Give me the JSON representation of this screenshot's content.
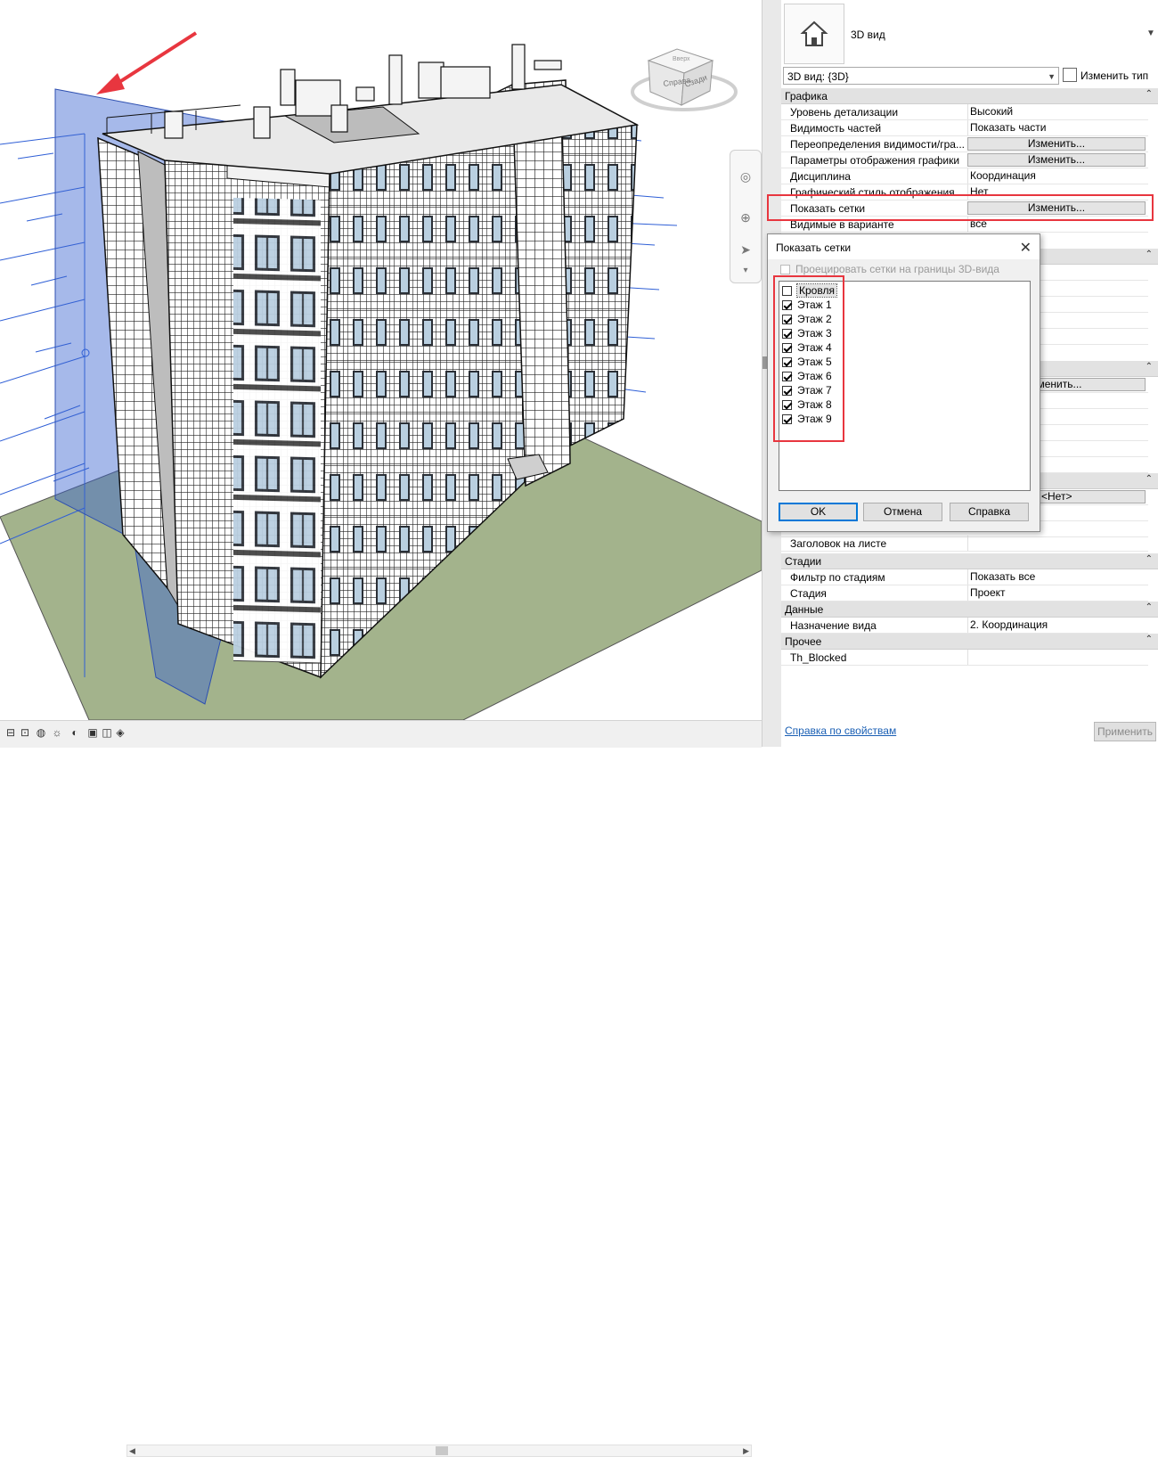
{
  "properties": {
    "type_name": "3D вид",
    "view_instance": "3D вид: {3D}",
    "edit_type_label": "Изменить тип",
    "groups": {
      "graphics": "Графика",
      "stages": "Стадии",
      "data": "Данные",
      "other": "Прочее"
    },
    "rows": {
      "detail_level": {
        "key": "Уровень детализации",
        "value": "Высокий"
      },
      "parts_visibility": {
        "key": "Видимость частей",
        "value": "Показать части"
      },
      "visibility_overrides": {
        "key": "Переопределения видимости/гра...",
        "value": "Изменить..."
      },
      "graphic_display": {
        "key": "Параметры отображения графики",
        "value": "Изменить..."
      },
      "discipline": {
        "key": "Дисциплина",
        "value": "Координация"
      },
      "graphic_style": {
        "key": "Графический стиль отображения",
        "value": "Нет"
      },
      "show_grids": {
        "key": "Показать сетки",
        "value": "Изменить..."
      },
      "visible_in_option": {
        "key": "Видимые в варианте",
        "value": "все"
      },
      "partial_edit": {
        "value": "зменить..."
      },
      "partial_none": {
        "value": "<Нет>"
      },
      "sheet_title": {
        "key": "Заголовок на листе",
        "value": ""
      },
      "phase_filter": {
        "key": "Фильтр по стадиям",
        "value": "Показать все"
      },
      "phase": {
        "key": "Стадия",
        "value": "Проект"
      },
      "view_purpose": {
        "key": "Назначение вида",
        "value": "2. Координация"
      },
      "th_blocked": {
        "key": "Th_Blocked",
        "value": ""
      }
    },
    "help_link": "Справка по свойствам",
    "apply_label": "Применить"
  },
  "dialog": {
    "title": "Показать сетки",
    "project_grids_label": "Проецировать сетки на границы 3D-вида",
    "levels": [
      {
        "name": "Кровля",
        "checked": false
      },
      {
        "name": "Этаж 1",
        "checked": true
      },
      {
        "name": "Этаж 2",
        "checked": true
      },
      {
        "name": "Этаж 3",
        "checked": true
      },
      {
        "name": "Этаж 4",
        "checked": true
      },
      {
        "name": "Этаж 5",
        "checked": true
      },
      {
        "name": "Этаж 6",
        "checked": true
      },
      {
        "name": "Этаж 7",
        "checked": true
      },
      {
        "name": "Этаж 8",
        "checked": true
      },
      {
        "name": "Этаж 9",
        "checked": true
      }
    ],
    "ok_label": "OK",
    "cancel_label": "Отмена",
    "help_label": "Справка"
  },
  "viewcube": {
    "right_face": "Справа",
    "back_face": "Сзади",
    "top_face": "Вверх"
  },
  "colors": {
    "highlight_red": "#e8363f",
    "arrow_red": "#e8363f",
    "grid_blue": "#2f5fd6",
    "section_plane": "#3a63d1",
    "ground": "#a3b38c"
  }
}
